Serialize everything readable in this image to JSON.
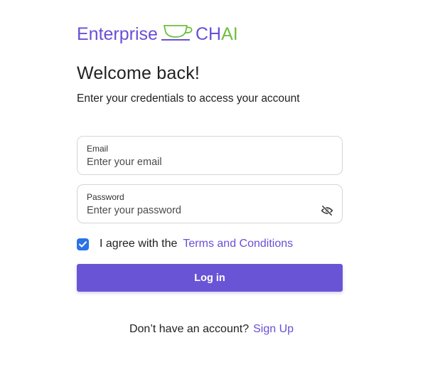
{
  "brand": {
    "part1": "Enterprise",
    "part2_ch": "CH",
    "part2_ai": "AI",
    "logo_icon": "teacup-icon",
    "colors": {
      "primary": "#6a4fd6",
      "accent": "#6fbf3f"
    }
  },
  "heading": {
    "title": "Welcome back!",
    "subtitle": "Enter your credentials to access your account"
  },
  "form": {
    "email": {
      "label": "Email",
      "placeholder": "Enter your email",
      "value": ""
    },
    "password": {
      "label": "Password",
      "placeholder": "Enter your password",
      "value": "",
      "toggle_icon": "eye-off-icon"
    },
    "agree": {
      "checked": true,
      "text": "I agree with the",
      "link": "Terms and Conditions"
    },
    "submit_label": "Log in"
  },
  "footer": {
    "prompt": "Don’t have an account?",
    "signup_label": "Sign Up"
  }
}
